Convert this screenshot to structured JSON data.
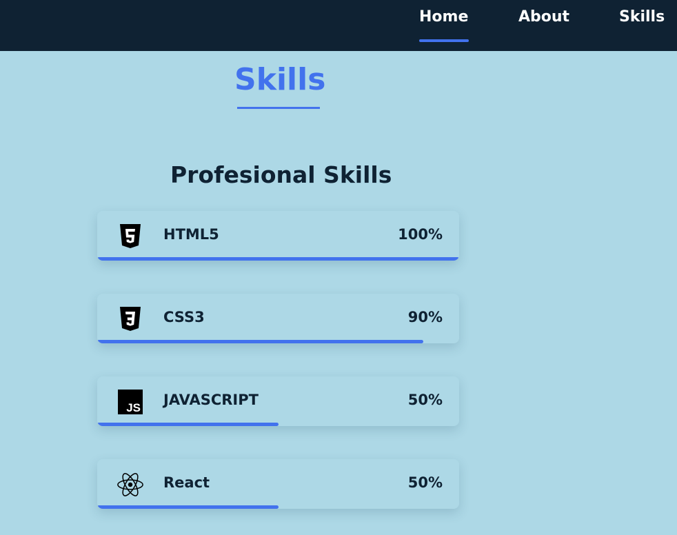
{
  "nav": {
    "links": [
      "Home",
      "About",
      "Skills"
    ],
    "active": "Home"
  },
  "section": {
    "title": "Skills",
    "subtitle": "Profesional Skills"
  },
  "skills": [
    {
      "name": "HTML5",
      "percent_label": "100%",
      "percent": 100,
      "icon": "html5-icon"
    },
    {
      "name": "CSS3",
      "percent_label": "90%",
      "percent": 90,
      "icon": "css3-icon"
    },
    {
      "name": "JAVASCRIPT",
      "percent_label": "50%",
      "percent": 50,
      "icon": "javascript-icon"
    },
    {
      "name": "React",
      "percent_label": "50%",
      "percent": 50,
      "icon": "react-icon"
    }
  ],
  "colors": {
    "nav_background": "#0f2233",
    "page_background": "#add8e6",
    "accent": "#4272ed",
    "text_dark": "#0f2233"
  }
}
